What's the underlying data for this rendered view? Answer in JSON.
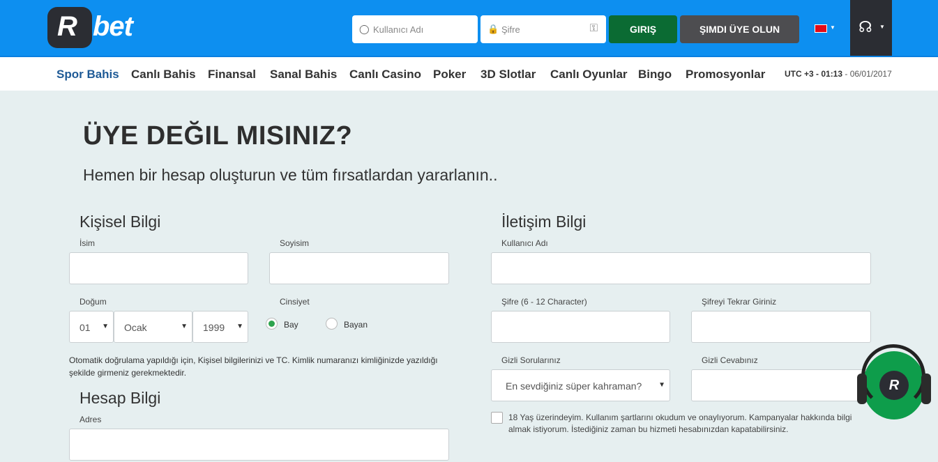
{
  "brand": {
    "logo_letter": "R",
    "logo_text": "bet"
  },
  "header": {
    "username_placeholder": "Kullanıcı Adı",
    "password_placeholder": "Şifre",
    "login_label": "GIRIŞ",
    "signup_label": "ŞIMDI ÜYE OLUN",
    "language_flag": "flag-icon-tr",
    "support_icon": "headset-icon"
  },
  "nav": {
    "items": [
      "Spor Bahis",
      "Canlı Bahis",
      "Finansal",
      "Sanal Bahis",
      "Canlı Casino",
      "Poker",
      "3D Slotlar",
      "Canlı Oyunlar",
      "Bingo",
      "Promosyonlar"
    ],
    "active_index": 0,
    "clock_prefix": "UTC +3 - 01:13",
    "clock_date": " - 06/01/2017"
  },
  "page": {
    "title": "ÜYE DEĞIL MISINIZ?",
    "subtitle": "Hemen bir hesap oluşturun ve tüm fırsatlardan yararlanın.."
  },
  "personal": {
    "title": "Kişisel Bilgi",
    "first_name_label": "İsim",
    "last_name_label": "Soyisim",
    "birth_label": "Doğum",
    "birth_day": "01",
    "birth_month": "Ocak",
    "birth_year": "1999",
    "gender_label": "Cinsiyet",
    "gender_male": "Bay",
    "gender_female": "Bayan",
    "gender_selected": "Bay",
    "note": "Otomatik doğrulama yapıldığı için, Kişisel bilgilerinizi ve TC. Kimlik numaranızı kimliğinizde yazıldığı şekilde girmeniz gerekmektedir."
  },
  "account": {
    "title": "Hesap Bilgi",
    "address_label": "Adres"
  },
  "contact": {
    "title": "İletişim Bilgi",
    "username_label": "Kullanıcı Adı",
    "password_label": "Şifre (6 - 12 Character)",
    "password_repeat_label": "Şifreyi Tekrar Giriniz",
    "secret_question_label": "Gizli Sorularınız",
    "secret_question_value": "En sevdiğiniz süper kahraman?",
    "secret_answer_label": "Gizli Cevabınız",
    "consent_text": "18 Yaş üzerindeyim. Kullanım şartlarını okudum ve onaylıyorum. Kampanyalar hakkında bilgi almak istiyorum. İstediğiniz zaman bu hizmeti hesabınızdan kapatabilirsiniz.",
    "consent_checked": false
  },
  "support_widget": {
    "letter": "R",
    "icon": "live-support-icon",
    "color": "#0e9d4b"
  },
  "colors": {
    "header_bg": "#0d8ff0",
    "login_btn": "#0b6b33",
    "signup_btn": "#4d4d50",
    "page_bg": "#e6eff0",
    "nav_active": "#1e5a96"
  }
}
